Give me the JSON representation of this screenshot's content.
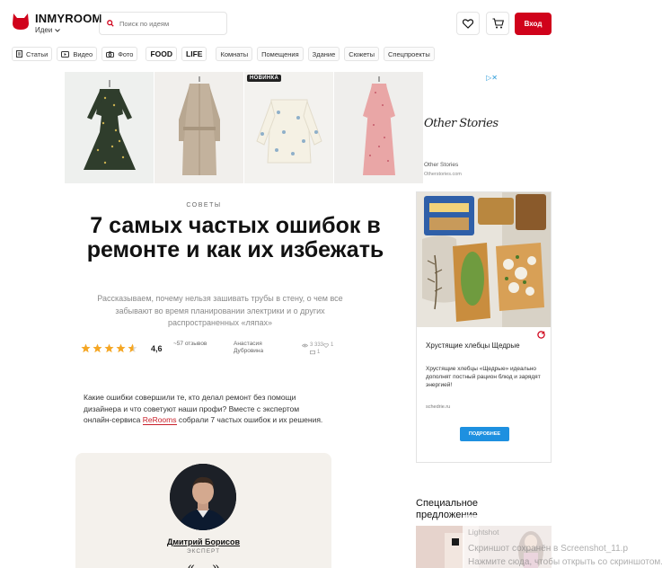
{
  "header": {
    "logo": "INMYROOM",
    "section": "Идеи",
    "search_placeholder": "Поиск по идеям",
    "login_label": "Вход"
  },
  "nav": {
    "items": [
      "Статьи",
      "Видео",
      "Фото",
      "FOOD",
      "LIFE",
      "Комнаты",
      "Помещения",
      "Здание",
      "Сюжеты",
      "Спецпроекты"
    ]
  },
  "banner_ad": {
    "badge": "НОВИНКА",
    "brand": "Other Stories",
    "brand_line": "Other Stories",
    "brand_url": "Otherstories.com"
  },
  "article": {
    "kicker": "СОВЕТЫ",
    "title": "7 самых частых ошибок в ремонте и как их избежать",
    "lede": "Рассказываем, почему нельзя зашивать трубы в стену, о чем все забывают во время планировании электрики и о других распространенных «ляпах»",
    "rating": "4,6",
    "reviews": "~57 отзывов",
    "author": "Анастасия Дубровина",
    "views": "3 333",
    "comments": "1",
    "likes": "1",
    "intro_before": "Какие ошибки совершили те, кто делал ремонт без помощи дизайнера и что советуют наши профи? Вместе с экспертом онлайн-сервиса ",
    "intro_link": "ReRooms",
    "intro_after": " собрали 7 частых ошибок и их решения."
  },
  "expert": {
    "name": "Дмитрий Борисов",
    "role": "ЭКСПЕРТ",
    "quote": "« ... »"
  },
  "side_ad": {
    "title": "Хрустящие хлебцы Щедрые",
    "text": "Хрустящие хлебцы «Щедрые» идеально дополнят постный рацион блюд и зарядят энергией!",
    "url": "schedrie.ru",
    "button": "ПОДРОБНЕЕ"
  },
  "special": {
    "heading": "Специальное предложение"
  },
  "toast": {
    "line1": "Lightshot",
    "line2": "Скриншот сохранён в Screenshot_11.p",
    "line3": "Нажмите сюда, чтобы открыть со скриншотом."
  },
  "colors": {
    "brand_red": "#d0021b",
    "star": "#f5a623",
    "link": "#c8202a",
    "button_blue": "#1e90e0"
  }
}
